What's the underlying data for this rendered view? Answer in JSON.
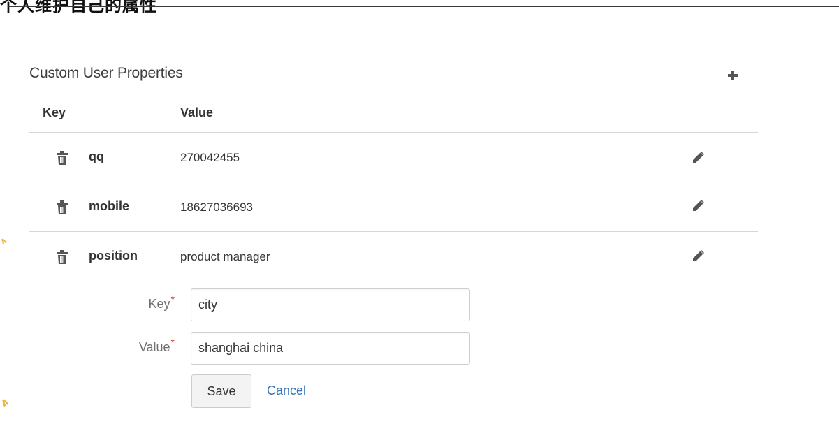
{
  "heading_clip": "个人维护自己的属性",
  "section": {
    "title": "Custom User Properties",
    "add_icon": "plus-icon"
  },
  "table": {
    "columns": [
      "Key",
      "Value"
    ],
    "rows": [
      {
        "key": "qq",
        "value": "270042455",
        "delete_icon": "trash-icon",
        "edit_icon": "pencil-icon"
      },
      {
        "key": "mobile",
        "value": "18627036693",
        "delete_icon": "trash-icon",
        "edit_icon": "pencil-icon"
      },
      {
        "key": "position",
        "value": "product manager",
        "delete_icon": "trash-icon",
        "edit_icon": "pencil-icon"
      }
    ]
  },
  "form": {
    "key_label": "Key",
    "key_value": "city",
    "value_label": "Value",
    "value_value": "shanghai china",
    "required_mark": "*",
    "save_label": "Save",
    "cancel_label": "Cancel"
  },
  "colors": {
    "link": "#3572b0",
    "required": "#d04437",
    "divider": "#d7d7d7",
    "watermark": "#f3b53a"
  }
}
